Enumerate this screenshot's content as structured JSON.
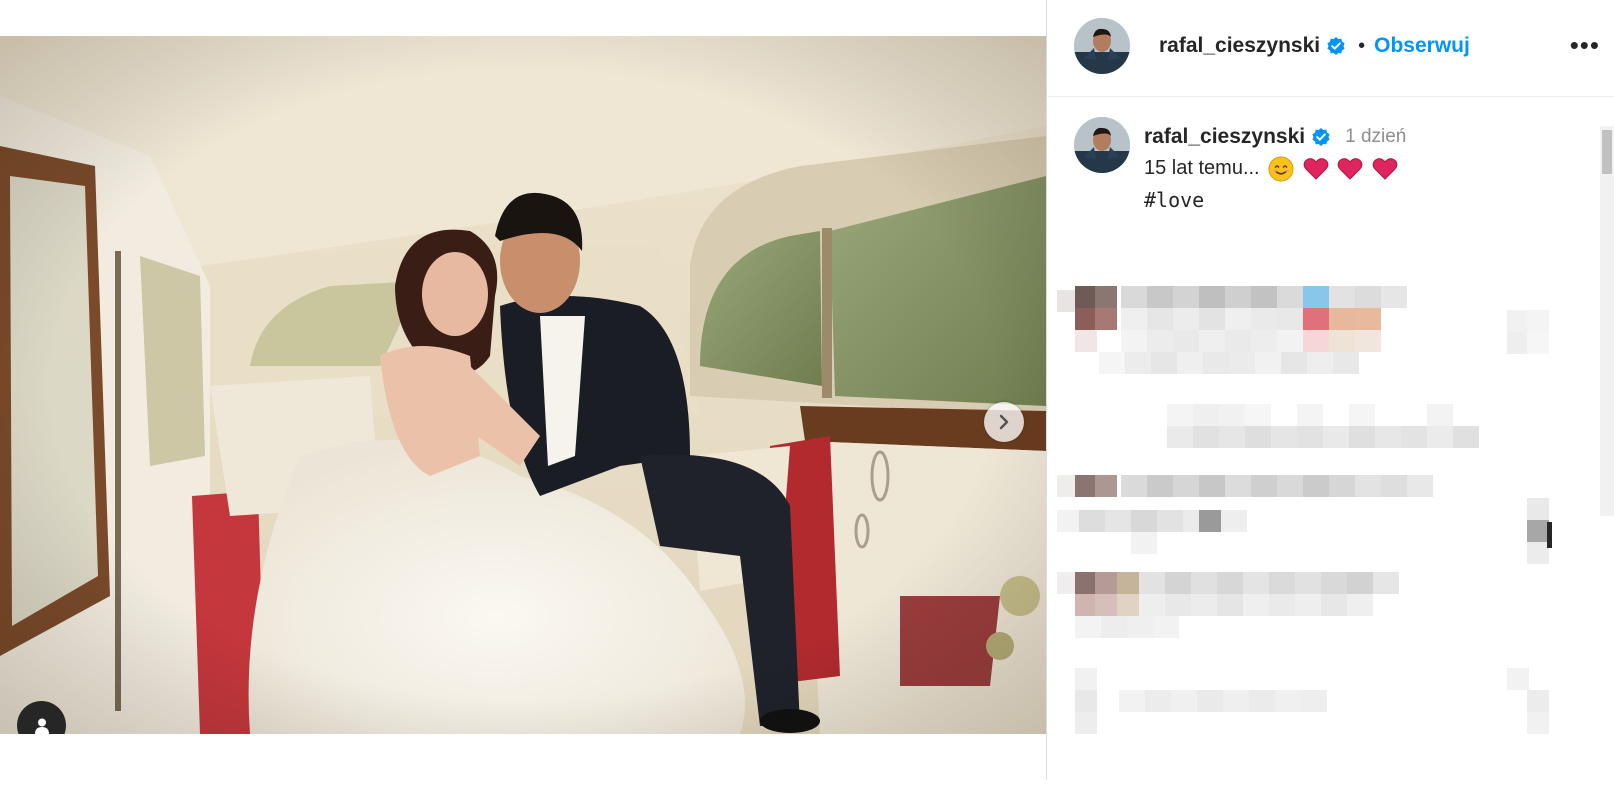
{
  "post": {
    "author": "rafal_cieszynski",
    "follow_label": "Obserwuj",
    "separator": "•",
    "more_label": "•••",
    "time_ago": "1 dzień",
    "caption_text": "15 lat temu...",
    "caption_hashtag": "#love",
    "carousel": {
      "count": 4,
      "active_index": 0
    }
  },
  "colors": {
    "accent": "#0095f6",
    "verified": "#0095f6",
    "heart": "#e0245e"
  },
  "icons": {
    "next": "chevron-right-icon",
    "tag": "user-tag-icon",
    "verified": "verified-badge-icon"
  }
}
